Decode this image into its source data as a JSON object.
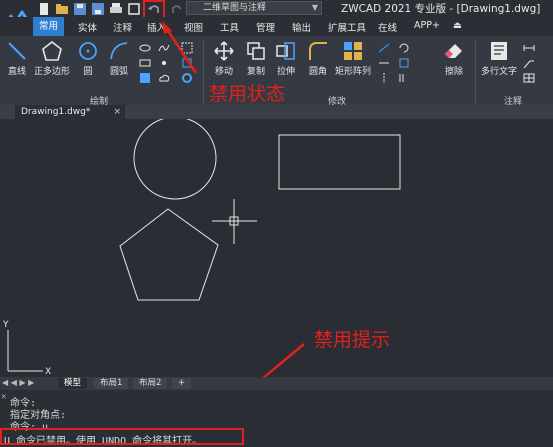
{
  "quick_access": {
    "workspace": "二维草图与注释",
    "app_title": "ZWCAD 2021 专业版 - [Drawing1.dwg]"
  },
  "ribbon_tabs": [
    "常用",
    "实体",
    "注释",
    "插入",
    "视图",
    "工具",
    "管理",
    "输出",
    "扩展工具",
    "在线",
    "APP+"
  ],
  "ribbon": {
    "draw_tools": [
      "直线",
      "正多边形",
      "圆",
      "圆弧"
    ],
    "modify_tools": [
      "移动",
      "复制",
      "拉伸",
      "圆角",
      "矩形阵列",
      "擦除"
    ],
    "annotation_tools": [
      "多行文字"
    ],
    "groups": [
      "绘制",
      "修改",
      "注释"
    ]
  },
  "document_tab": {
    "name": "Drawing1.dwg*",
    "close": "×"
  },
  "canvas": {
    "axis_y": "Y",
    "axis_x": "X"
  },
  "layout_tabs": [
    "模型",
    "布局1",
    "布局2",
    "+"
  ],
  "command_lines": [
    "命令:",
    "指定对角点:",
    "命令: u",
    "U 命令已禁用。使用 UNDO 命令将其打开。"
  ],
  "annotations": {
    "disabled_state": "禁用状态",
    "disabled_hint": "禁用提示"
  },
  "colors": {
    "accent": "#2f7fd0",
    "annotation_red": "#e0211d",
    "canvas": "#2a2d33"
  }
}
